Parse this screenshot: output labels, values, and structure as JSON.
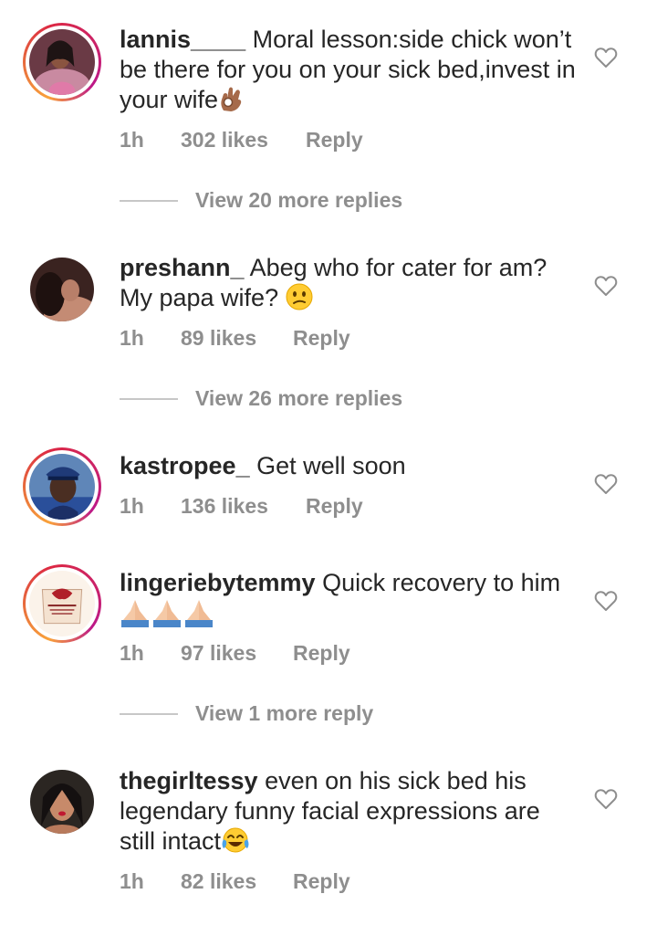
{
  "comments": [
    {
      "username": "lannis____",
      "text": "Moral lesson:side chick won’t be there for you on your sick bed,invest in your wife",
      "emoji": "ok-hand-emoji",
      "time": "1h",
      "likes": "302 likes",
      "reply": "Reply",
      "view_more": "View 20 more replies"
    },
    {
      "username": "preshann_",
      "text": "Abeg who for cater for am? My papa wife?",
      "emoji": "confused-face-emoji",
      "time": "1h",
      "likes": "89 likes",
      "reply": "Reply",
      "view_more": "View 26 more replies"
    },
    {
      "username": "kastropee_",
      "text": "Get well soon",
      "time": "1h",
      "likes": "136 likes",
      "reply": "Reply"
    },
    {
      "username": "lingeriebytemmy",
      "text": "Quick recovery to him",
      "emoji": "praying-hands-emoji",
      "time": "1h",
      "likes": "97 likes",
      "reply": "Reply",
      "view_more": "View 1 more reply"
    },
    {
      "username": "thegirltessy",
      "text": "even on his sick bed his legendary funny facial expressions are still intact",
      "emoji": "tears-of-joy-emoji",
      "time": "1h",
      "likes": "82 likes",
      "reply": "Reply"
    }
  ],
  "icons": {
    "like": "heart-outline-icon"
  },
  "colors": {
    "text_primary": "#262626",
    "text_secondary": "#8e8e8e",
    "divider": "#c7c7c7",
    "story_ring": [
      "#f9a23b",
      "#dc2743",
      "#bc1888"
    ]
  }
}
